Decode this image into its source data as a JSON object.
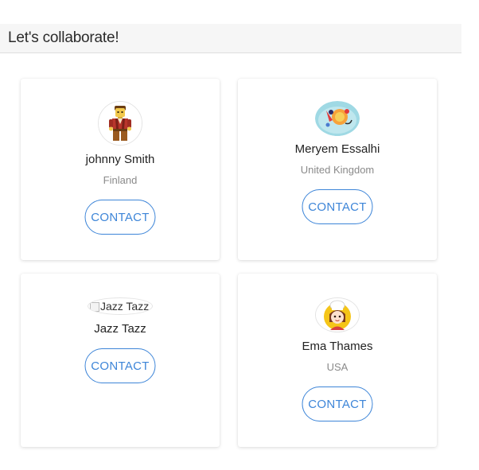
{
  "header": {
    "title": "Let's collaborate!"
  },
  "colors": {
    "accent": "#3d85d8",
    "header_bg": "#f6f6f6",
    "card_bg": "#ffffff",
    "country_text": "#8a8a8a"
  },
  "cards": [
    {
      "name": "johnny Smith",
      "country": "Finland",
      "avatar_icon": "lego-figure-avatar",
      "contact_label": "CONTACT"
    },
    {
      "name": "Meryem Essalhi",
      "country": "United Kingdom",
      "avatar_icon": "cartoon-avatar",
      "contact_label": "CONTACT"
    },
    {
      "name": "Jazz Tazz",
      "avatar_alt": "Jazz Tazz",
      "avatar_icon": "broken-image-avatar",
      "contact_label": "CONTACT"
    },
    {
      "name": "Ema Thames",
      "country": "USA",
      "avatar_icon": "chef-avatar",
      "contact_label": "CONTACT"
    }
  ]
}
